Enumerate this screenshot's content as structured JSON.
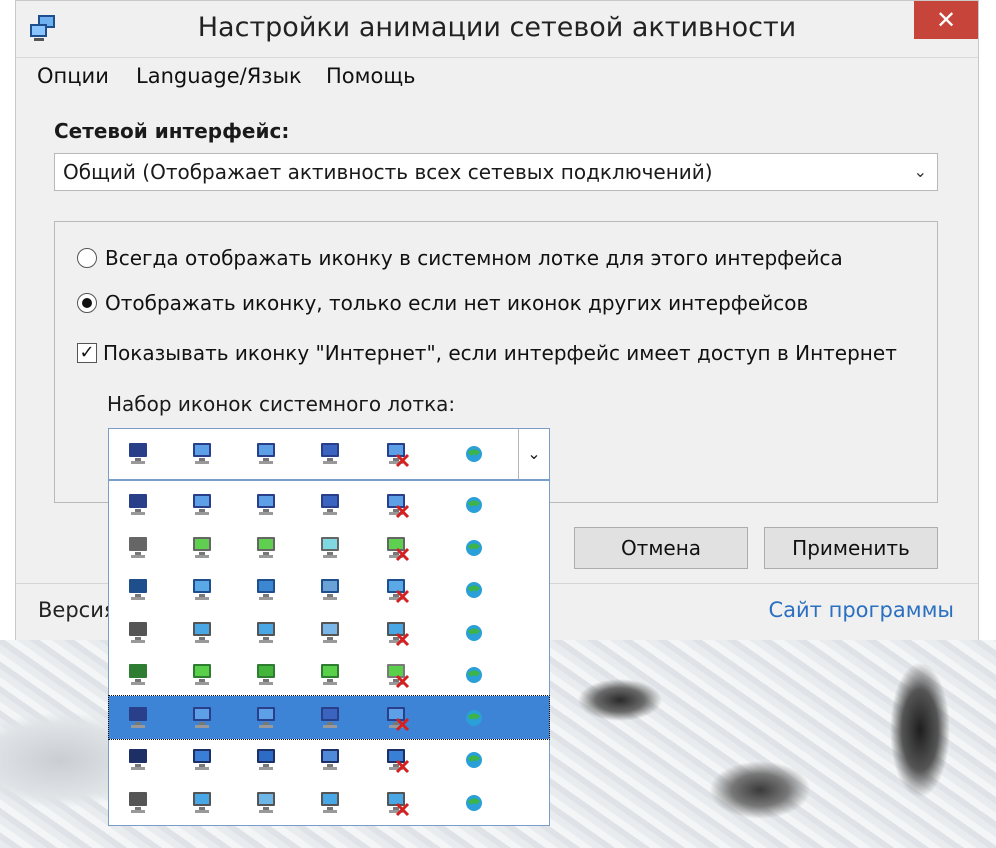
{
  "window": {
    "title": "Настройки анимации сетевой активности",
    "close_glyph": "✕"
  },
  "menu": [
    "Опции",
    "Language/Язык",
    "Помощь"
  ],
  "interface": {
    "label": "Сетевой интерфейс:",
    "selected": "Общий (Отображает активность всех сетевых подключений)"
  },
  "options": {
    "radio_always": "Всегда отображать иконку в системном лотке для этого интерфейса",
    "radio_only_if_none": "Отображать иконку, только если нет иконок других интерфейсов",
    "checkbox_internet": "Показывать иконку \"Интернет\", если интерфейс имеет доступ в Интернет",
    "radio_selected": "radio_only_if_none",
    "checkbox_checked": true
  },
  "icon_set": {
    "label": "Набор иконок системного лотка:",
    "selected_row_index": 5,
    "styles": [
      "classic-monitor",
      "twin-terminals",
      "square-monitors",
      "outline-monitors",
      "green-monitors",
      "classic-monitor",
      "dark-monitors",
      "wireless-monitors"
    ],
    "colors": {
      "accent": "#3d84d6",
      "x_mark": "#d42020"
    }
  },
  "buttons": {
    "cancel": "Отмена",
    "apply": "Применить"
  },
  "footer": {
    "version": "Версия",
    "site_link": "Сайт программы"
  }
}
